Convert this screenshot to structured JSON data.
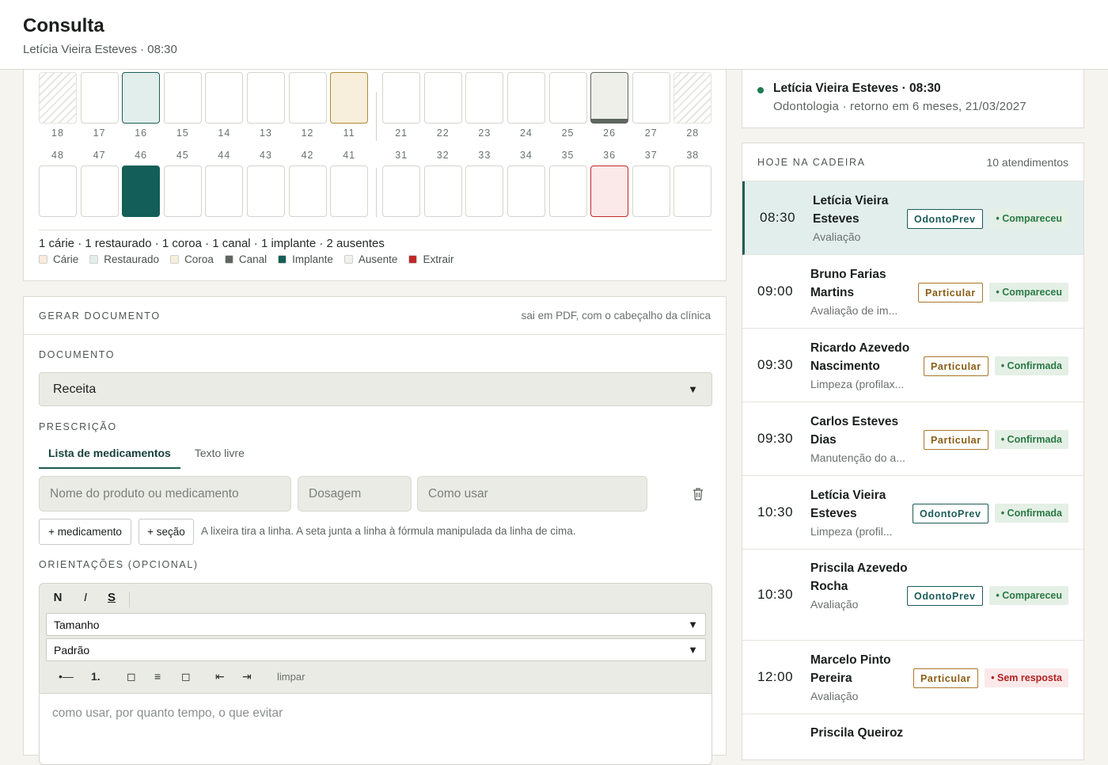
{
  "header": {
    "title": "Consulta",
    "subtitle": "Letícia Vieira Esteves · 08:30"
  },
  "odontogram": {
    "upper": [
      {
        "n": "18",
        "state": "absent"
      },
      {
        "n": "17",
        "state": "healthy"
      },
      {
        "n": "16",
        "state": "restored"
      },
      {
        "n": "15",
        "state": "healthy"
      },
      {
        "n": "14",
        "state": "healthy"
      },
      {
        "n": "13",
        "state": "healthy"
      },
      {
        "n": "12",
        "state": "healthy"
      },
      {
        "n": "11",
        "state": "crown"
      },
      {
        "n": "21",
        "state": "healthy"
      },
      {
        "n": "22",
        "state": "healthy"
      },
      {
        "n": "23",
        "state": "healthy"
      },
      {
        "n": "24",
        "state": "healthy"
      },
      {
        "n": "25",
        "state": "healthy"
      },
      {
        "n": "26",
        "state": "canal"
      },
      {
        "n": "27",
        "state": "healthy"
      },
      {
        "n": "28",
        "state": "absent"
      }
    ],
    "lower": [
      {
        "n": "48",
        "state": "healthy"
      },
      {
        "n": "47",
        "state": "healthy"
      },
      {
        "n": "46",
        "state": "implant"
      },
      {
        "n": "45",
        "state": "healthy"
      },
      {
        "n": "44",
        "state": "healthy"
      },
      {
        "n": "43",
        "state": "healthy"
      },
      {
        "n": "42",
        "state": "healthy"
      },
      {
        "n": "41",
        "state": "healthy"
      },
      {
        "n": "31",
        "state": "healthy"
      },
      {
        "n": "32",
        "state": "healthy"
      },
      {
        "n": "33",
        "state": "healthy"
      },
      {
        "n": "34",
        "state": "healthy"
      },
      {
        "n": "35",
        "state": "healthy"
      },
      {
        "n": "36",
        "state": "extract"
      },
      {
        "n": "37",
        "state": "healthy"
      },
      {
        "n": "38",
        "state": "healthy"
      }
    ],
    "summary": "1 cárie · 1 restaurado · 1 coroa · 1 canal · 1 implante · 2 ausentes",
    "legend": [
      {
        "label": "Cárie",
        "color": "#fbeadf"
      },
      {
        "label": "Restaurado",
        "color": "#e2eeec"
      },
      {
        "label": "Coroa",
        "color": "#f7efdb"
      },
      {
        "label": "Canal",
        "color": "#5f6661"
      },
      {
        "label": "Implante",
        "color": "#135e58"
      },
      {
        "label": "Ausente",
        "color": "#f0f1ec"
      },
      {
        "label": "Extrair",
        "color": "#c0292b"
      }
    ]
  },
  "document": {
    "header": "GERAR DOCUMENTO",
    "hint": "sai em PDF, com o cabeçalho da clínica",
    "doc_label": "DOCUMENTO",
    "doc_value": "Receita",
    "presc_label": "PRESCRIÇÃO",
    "tabs": [
      "Lista de medicamentos",
      "Texto livre"
    ],
    "fields": {
      "name": "Nome do produto ou medicamento",
      "dose": "Dosagem",
      "use": "Como usar"
    },
    "add_med": "+ medicamento",
    "add_sec": "+ seção",
    "btn_hint": "A lixeira tira a linha. A seta junta a linha à fórmula manipulada da linha de cima.",
    "orient_label": "ORIENTAÇÕES (OPCIONAL)",
    "format": {
      "bold": "N",
      "italic": "I",
      "strike": "S"
    },
    "size_select": "Tamanho",
    "font_select": "Padrão",
    "tools": {
      "bullet": "•—",
      "ordered": "1.",
      "sq1": "◻",
      "center": "≡",
      "sq2": "◻",
      "outdent": "⇤",
      "indent": "⇥"
    },
    "clear": "limpar",
    "placeholder": "como usar, por quanto tempo, o que evitar"
  },
  "patient": {
    "name": "Letícia Vieira Esteves · 08:30",
    "detail": "Odontologia · retorno em 6 meses, 21/03/2027"
  },
  "today": {
    "header": "HOJE NA CADEIRA",
    "count": "10 atendimentos",
    "rows": [
      {
        "time": "08:30",
        "name": "Letícia Vieira Esteves",
        "proc": "Avaliação",
        "ins": "OdontoPrev",
        "status": "• Compareceu",
        "st": "ok",
        "active": true
      },
      {
        "time": "09:00",
        "name": "Bruno Farias Martins",
        "proc": "Avaliação de im...",
        "ins": "Particular",
        "status": "• Compareceu",
        "st": "ok"
      },
      {
        "time": "09:30",
        "name": "Ricardo Azevedo Nascimento",
        "proc": "Limpeza (profilax...",
        "ins": "Particular",
        "status": "• Confirmada",
        "st": "conf"
      },
      {
        "time": "09:30",
        "name": "Carlos Esteves Dias",
        "proc": "Manutenção do a...",
        "ins": "Particular",
        "status": "• Confirmada",
        "st": "conf"
      },
      {
        "time": "10:30",
        "name": "Letícia Vieira Esteves",
        "proc": "Limpeza (profil...",
        "ins": "OdontoPrev",
        "status": "• Confirmada",
        "st": "conf"
      },
      {
        "time": "10:30",
        "name": "Priscila Azevedo Rocha",
        "proc": "Avaliação",
        "ins": "OdontoPrev",
        "status": "• Compareceu",
        "st": "ok"
      },
      {
        "time": "12:00",
        "name": "Marcelo Pinto Pereira",
        "proc": "Avaliação",
        "ins": "Particular",
        "status": "• Sem resposta",
        "st": "no"
      },
      {
        "time": "",
        "name": "Priscila Queiroz",
        "proc": "",
        "ins": "",
        "status": "",
        "st": "ok"
      }
    ]
  }
}
